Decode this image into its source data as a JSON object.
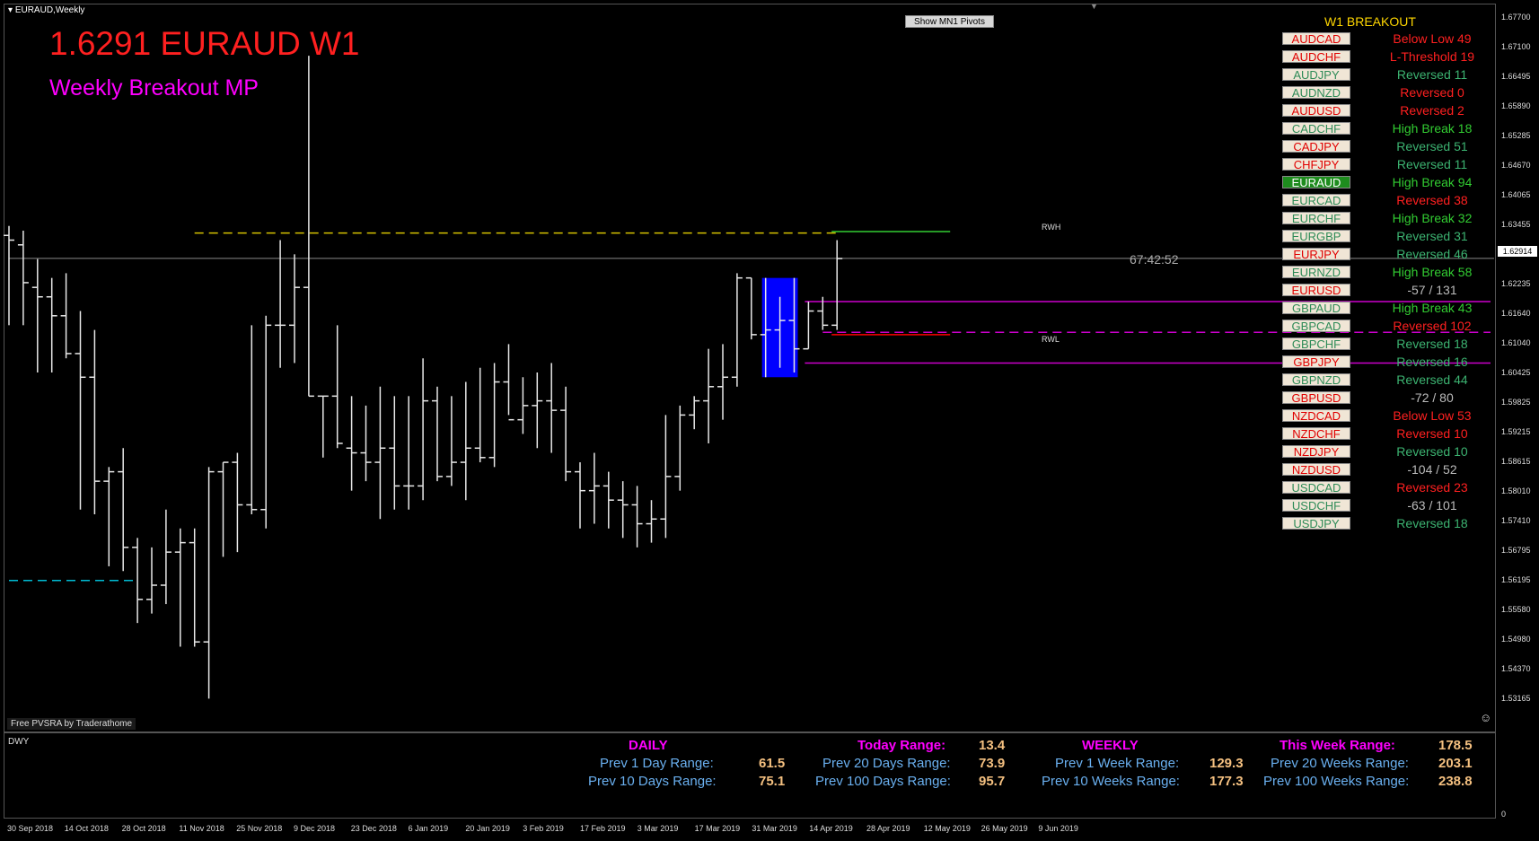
{
  "window": {
    "title": "EURAUD,Weekly"
  },
  "header": {
    "symbol_line": "1.6291 EURAUD W1",
    "subtitle": "Weekly Breakout MP"
  },
  "toolbar": {
    "pivots_button": "Show  MN1  Pivots"
  },
  "chart_labels": {
    "rwh": "RWH",
    "rwl": "RWL",
    "countdown": "67:42:52",
    "credit": "Free  PVSRA  by  Traderathome",
    "current_price": "1.62914"
  },
  "breakout": {
    "title": "W1 BREAKOUT",
    "rows": [
      {
        "pair": "AUDCAD",
        "pair_color": "#e00000",
        "status": "Below Low 49",
        "status_color": "#ff2020"
      },
      {
        "pair": "AUDCHF",
        "pair_color": "#e00000",
        "status": "L-Threshold 19",
        "status_color": "#ff2020"
      },
      {
        "pair": "AUDJPY",
        "pair_color": "#2e8b57",
        "status": "Reversed 11",
        "status_color": "#3cb371"
      },
      {
        "pair": "AUDNZD",
        "pair_color": "#2e8b57",
        "status": "Reversed 0",
        "status_color": "#ff2020"
      },
      {
        "pair": "AUDUSD",
        "pair_color": "#e00000",
        "status": "Reversed 2",
        "status_color": "#ff2020"
      },
      {
        "pair": "CADCHF",
        "pair_color": "#2e8b57",
        "status": "High Break 18",
        "status_color": "#32cd32"
      },
      {
        "pair": "CADJPY",
        "pair_color": "#e00000",
        "status": "Reversed 51",
        "status_color": "#3cb371"
      },
      {
        "pair": "CHFJPY",
        "pair_color": "#e00000",
        "status": "Reversed 11",
        "status_color": "#3cb371"
      },
      {
        "pair": "EURAUD",
        "pair_color": "#ffffff",
        "pair_bg": "#1e8c1e",
        "status": "High Break 94",
        "status_color": "#32cd32"
      },
      {
        "pair": "EURCAD",
        "pair_color": "#2e8b57",
        "status": "Reversed 38",
        "status_color": "#ff2020"
      },
      {
        "pair": "EURCHF",
        "pair_color": "#2e8b57",
        "status": "High Break 32",
        "status_color": "#32cd32"
      },
      {
        "pair": "EURGBP",
        "pair_color": "#2e8b57",
        "status": "Reversed 31",
        "status_color": "#3cb371"
      },
      {
        "pair": "EURJPY",
        "pair_color": "#e00000",
        "status": "Reversed 46",
        "status_color": "#3cb371"
      },
      {
        "pair": "EURNZD",
        "pair_color": "#2e8b57",
        "status": "High Break 58",
        "status_color": "#32cd32"
      },
      {
        "pair": "EURUSD",
        "pair_color": "#e00000",
        "status": "-57 / 131",
        "status_color": "#bbbbbb"
      },
      {
        "pair": "GBPAUD",
        "pair_color": "#2e8b57",
        "status": "High Break 43",
        "status_color": "#32cd32"
      },
      {
        "pair": "GBPCAD",
        "pair_color": "#2e8b57",
        "status": "Reversed 102",
        "status_color": "#ff2020"
      },
      {
        "pair": "GBPCHF",
        "pair_color": "#2e8b57",
        "status": "Reversed 18",
        "status_color": "#3cb371"
      },
      {
        "pair": "GBPJPY",
        "pair_color": "#e00000",
        "status": "Reversed 16",
        "status_color": "#3cb371"
      },
      {
        "pair": "GBPNZD",
        "pair_color": "#2e8b57",
        "status": "Reversed 44",
        "status_color": "#3cb371"
      },
      {
        "pair": "GBPUSD",
        "pair_color": "#e00000",
        "status": "-72 / 80",
        "status_color": "#bbbbbb"
      },
      {
        "pair": "NZDCAD",
        "pair_color": "#e00000",
        "status": "Below Low 53",
        "status_color": "#ff2020"
      },
      {
        "pair": "NZDCHF",
        "pair_color": "#e00000",
        "status": "Reversed 10",
        "status_color": "#ff2020"
      },
      {
        "pair": "NZDJPY",
        "pair_color": "#e00000",
        "status": "Reversed 10",
        "status_color": "#3cb371"
      },
      {
        "pair": "NZDUSD",
        "pair_color": "#e00000",
        "status": "-104 / 52",
        "status_color": "#bbbbbb"
      },
      {
        "pair": "USDCAD",
        "pair_color": "#2e8b57",
        "status": "Reversed 23",
        "status_color": "#ff2020"
      },
      {
        "pair": "USDCHF",
        "pair_color": "#2e8b57",
        "status": "-63 / 101",
        "status_color": "#bbbbbb"
      },
      {
        "pair": "USDJPY",
        "pair_color": "#2e8b57",
        "status": "Reversed 18",
        "status_color": "#3cb371"
      }
    ]
  },
  "ranges": {
    "daily_head": "DAILY",
    "today_label": "Today  Range:",
    "today_value": "13.4",
    "prev1d_label": "Prev    1 Day  Range:",
    "prev1d_value": "61.5",
    "prev10d_label": "Prev  10  Days  Range:",
    "prev10d_value": "75.1",
    "prev20d_label": "Prev  20  Days  Range:",
    "prev20d_value": "73.9",
    "prev100d_label": "Prev  100  Days  Range:",
    "prev100d_value": "95.7",
    "weekly_head": "WEEKLY",
    "thisweek_label": "This  Week  Range:",
    "thisweek_value": "178.5",
    "prev1w_label": "Prev    1 Week  Range:",
    "prev1w_value": "129.3",
    "prev10w_label": "Prev  10  Weeks  Range:",
    "prev10w_value": "177.3",
    "prev20w_label": "Prev  20  Weeks  Range:",
    "prev20w_value": "203.1",
    "prev100w_label": "Prev  100  Weeks  Range:",
    "prev100w_value": "238.8"
  },
  "indicator": {
    "name": "DWY",
    "ticks": [
      "",
      "0"
    ]
  },
  "price_axis": [
    "1.67700",
    "1.67100",
    "1.66495",
    "1.65890",
    "1.65285",
    "1.64670",
    "1.64065",
    "1.63455",
    "1.62914",
    "1.62235",
    "1.61640",
    "1.61040",
    "1.60425",
    "1.59825",
    "1.59215",
    "1.58615",
    "1.58010",
    "1.57410",
    "1.56795",
    "1.56195",
    "1.55580",
    "1.54980",
    "1.54370",
    "1.53165"
  ],
  "time_axis": [
    "30 Sep 2018",
    "14 Oct 2018",
    "28 Oct 2018",
    "11 Nov 2018",
    "25 Nov 2018",
    "9 Dec 2018",
    "23 Dec 2018",
    "6 Jan 2019",
    "20 Jan 2019",
    "3 Feb 2019",
    "17 Feb 2019",
    "3 Mar 2019",
    "17 Mar 2019",
    "31 Mar 2019",
    "14 Apr 2019",
    "28 Apr 2019",
    "12 May 2019",
    "26 May 2019",
    "9 Jun 2019"
  ],
  "chart_data": {
    "type": "bar",
    "title": "1.6291 EURAUD W1",
    "symbol": "EURAUD",
    "timeframe": "Weekly",
    "ylim": [
      1.53,
      1.68
    ],
    "current_price": 1.62914,
    "bars": [
      {
        "o": 1.634,
        "h": 1.636,
        "l": 1.615,
        "c": 1.633
      },
      {
        "o": 1.632,
        "h": 1.635,
        "l": 1.615,
        "c": 1.624
      },
      {
        "o": 1.623,
        "h": 1.629,
        "l": 1.605,
        "c": 1.621
      },
      {
        "o": 1.621,
        "h": 1.625,
        "l": 1.605,
        "c": 1.617
      },
      {
        "o": 1.617,
        "h": 1.626,
        "l": 1.608,
        "c": 1.609
      },
      {
        "o": 1.609,
        "h": 1.618,
        "l": 1.576,
        "c": 1.604
      },
      {
        "o": 1.604,
        "h": 1.614,
        "l": 1.575,
        "c": 1.582
      },
      {
        "o": 1.582,
        "h": 1.585,
        "l": 1.564,
        "c": 1.584
      },
      {
        "o": 1.584,
        "h": 1.589,
        "l": 1.563,
        "c": 1.568
      },
      {
        "o": 1.568,
        "h": 1.57,
        "l": 1.552,
        "c": 1.557
      },
      {
        "o": 1.557,
        "h": 1.568,
        "l": 1.554,
        "c": 1.56
      },
      {
        "o": 1.56,
        "h": 1.576,
        "l": 1.556,
        "c": 1.567
      },
      {
        "o": 1.567,
        "h": 1.572,
        "l": 1.547,
        "c": 1.569
      },
      {
        "o": 1.569,
        "h": 1.572,
        "l": 1.547,
        "c": 1.548
      },
      {
        "o": 1.548,
        "h": 1.585,
        "l": 1.536,
        "c": 1.584
      },
      {
        "o": 1.584,
        "h": 1.586,
        "l": 1.566,
        "c": 1.586
      },
      {
        "o": 1.586,
        "h": 1.588,
        "l": 1.567,
        "c": 1.577
      },
      {
        "o": 1.577,
        "h": 1.615,
        "l": 1.575,
        "c": 1.576
      },
      {
        "o": 1.576,
        "h": 1.617,
        "l": 1.572,
        "c": 1.615
      },
      {
        "o": 1.615,
        "h": 1.633,
        "l": 1.606,
        "c": 1.615
      },
      {
        "o": 1.615,
        "h": 1.63,
        "l": 1.607,
        "c": 1.623
      },
      {
        "o": 1.623,
        "h": 1.672,
        "l": 1.6,
        "c": 1.6
      },
      {
        "o": 1.6,
        "h": 1.6,
        "l": 1.587,
        "c": 1.6
      },
      {
        "o": 1.6,
        "h": 1.615,
        "l": 1.589,
        "c": 1.59
      },
      {
        "o": 1.589,
        "h": 1.6,
        "l": 1.58,
        "c": 1.588
      },
      {
        "o": 1.588,
        "h": 1.598,
        "l": 1.582,
        "c": 1.586
      },
      {
        "o": 1.586,
        "h": 1.602,
        "l": 1.574,
        "c": 1.589
      },
      {
        "o": 1.589,
        "h": 1.6,
        "l": 1.576,
        "c": 1.581
      },
      {
        "o": 1.581,
        "h": 1.6,
        "l": 1.576,
        "c": 1.581
      },
      {
        "o": 1.581,
        "h": 1.608,
        "l": 1.578,
        "c": 1.599
      },
      {
        "o": 1.599,
        "h": 1.602,
        "l": 1.582,
        "c": 1.583
      },
      {
        "o": 1.583,
        "h": 1.6,
        "l": 1.581,
        "c": 1.586
      },
      {
        "o": 1.586,
        "h": 1.603,
        "l": 1.578,
        "c": 1.589
      },
      {
        "o": 1.589,
        "h": 1.606,
        "l": 1.586,
        "c": 1.587
      },
      {
        "o": 1.587,
        "h": 1.607,
        "l": 1.585,
        "c": 1.603
      },
      {
        "o": 1.603,
        "h": 1.611,
        "l": 1.596,
        "c": 1.595
      },
      {
        "o": 1.595,
        "h": 1.604,
        "l": 1.592,
        "c": 1.598
      },
      {
        "o": 1.598,
        "h": 1.605,
        "l": 1.589,
        "c": 1.599
      },
      {
        "o": 1.599,
        "h": 1.607,
        "l": 1.588,
        "c": 1.597
      },
      {
        "o": 1.597,
        "h": 1.602,
        "l": 1.582,
        "c": 1.584
      },
      {
        "o": 1.584,
        "h": 1.586,
        "l": 1.572,
        "c": 1.58
      },
      {
        "o": 1.58,
        "h": 1.588,
        "l": 1.573,
        "c": 1.581
      },
      {
        "o": 1.581,
        "h": 1.584,
        "l": 1.572,
        "c": 1.578
      },
      {
        "o": 1.578,
        "h": 1.582,
        "l": 1.57,
        "c": 1.577
      },
      {
        "o": 1.577,
        "h": 1.581,
        "l": 1.568,
        "c": 1.573
      },
      {
        "o": 1.573,
        "h": 1.578,
        "l": 1.569,
        "c": 1.574
      },
      {
        "o": 1.574,
        "h": 1.596,
        "l": 1.57,
        "c": 1.583
      },
      {
        "o": 1.583,
        "h": 1.598,
        "l": 1.58,
        "c": 1.596
      },
      {
        "o": 1.596,
        "h": 1.6,
        "l": 1.593,
        "c": 1.599
      },
      {
        "o": 1.599,
        "h": 1.61,
        "l": 1.59,
        "c": 1.602
      },
      {
        "o": 1.602,
        "h": 1.611,
        "l": 1.595,
        "c": 1.604
      },
      {
        "o": 1.604,
        "h": 1.626,
        "l": 1.602,
        "c": 1.625
      },
      {
        "o": 1.625,
        "h": 1.625,
        "l": 1.612,
        "c": 1.613
      },
      {
        "o": 1.613,
        "h": 1.625,
        "l": 1.604,
        "c": 1.614
      },
      {
        "o": 1.614,
        "h": 1.621,
        "l": 1.606,
        "c": 1.616
      },
      {
        "o": 1.616,
        "h": 1.625,
        "l": 1.605,
        "c": 1.61
      },
      {
        "o": 1.61,
        "h": 1.62,
        "l": 1.61,
        "c": 1.618
      },
      {
        "o": 1.618,
        "h": 1.621,
        "l": 1.614,
        "c": 1.615
      },
      {
        "o": 1.615,
        "h": 1.633,
        "l": 1.614,
        "c": 1.6291
      }
    ],
    "levels": [
      {
        "name": "RWH",
        "value": 1.6348,
        "color": "#32cd32",
        "style": "solid"
      },
      {
        "name": "RWL",
        "value": 1.613,
        "color": "#ff0000",
        "style": "solid"
      },
      {
        "name": "prev-high",
        "value": 1.6345,
        "color": "#d4c000",
        "style": "dashed"
      },
      {
        "name": "upper-band",
        "value": 1.62,
        "color": "#cc00cc",
        "style": "solid"
      },
      {
        "name": "mid-band",
        "value": 1.6135,
        "color": "#cc00cc",
        "style": "dashed"
      },
      {
        "name": "lower-band",
        "value": 1.607,
        "color": "#cc00cc",
        "style": "solid"
      },
      {
        "name": "low-level",
        "value": 1.561,
        "color": "#00bcd4",
        "style": "dashed"
      }
    ],
    "box": {
      "from_bar": 53,
      "to_bar": 55,
      "top": 1.625,
      "bottom": 1.604,
      "color": "#0000ff"
    }
  }
}
